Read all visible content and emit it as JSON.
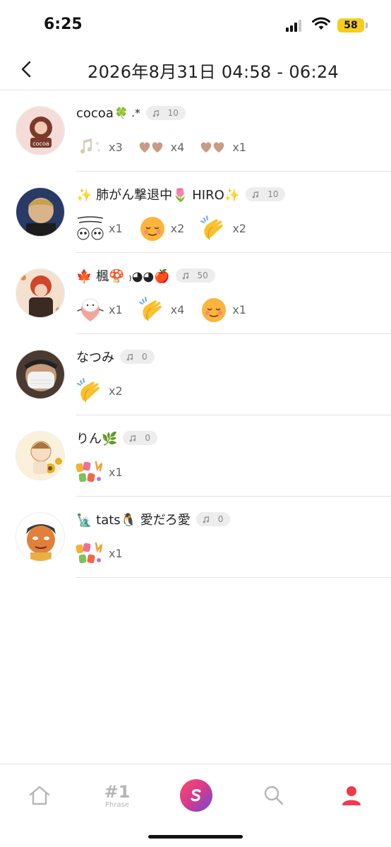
{
  "status_bar": {
    "time": "6:25",
    "battery": "58"
  },
  "header": {
    "title": "2026年8月31日 04:58 - 06:24",
    "back_icon": "chevron-left-icon"
  },
  "listeners": [
    {
      "name": "cocoa",
      "name_suffix": "🍀 .*",
      "notes": "10",
      "avatar_colors": [
        "#f6dcd8",
        "#7a3a2a"
      ],
      "reactions": [
        {
          "sticker": "music-notes-sticker",
          "count": "x3"
        },
        {
          "sticker": "hearts-sticker",
          "count": "x4"
        },
        {
          "sticker": "hearts-sticker",
          "count": "x1"
        }
      ]
    },
    {
      "name": "✨ 肺がん撃退中🌷 HIRO✨",
      "name_suffix": "",
      "notes": "10",
      "avatar_colors": [
        "#2a3a66",
        "#d9b48a"
      ],
      "reactions": [
        {
          "sticker": "pandas-thanks-sticker",
          "count": "x1"
        },
        {
          "sticker": "relieved-face-sticker",
          "count": "x2"
        },
        {
          "sticker": "clapping-hands-sticker",
          "count": "x2"
        }
      ]
    },
    {
      "name": "🍁 楓🍄 ₎◕◕🍎",
      "name_suffix": "",
      "notes": "50",
      "avatar_colors": [
        "#e88a4a",
        "#3a2a22"
      ],
      "reactions": [
        {
          "sticker": "heart-ghost-sticker",
          "count": "x1"
        },
        {
          "sticker": "clapping-hands-sticker",
          "count": "x4"
        },
        {
          "sticker": "relieved-face-sticker",
          "count": "x1"
        }
      ]
    },
    {
      "name": "なつみ",
      "name_suffix": "",
      "notes": "0",
      "avatar_colors": [
        "#cfcac4",
        "#4a3a32"
      ],
      "reactions": [
        {
          "sticker": "clapping-hands-sticker",
          "count": "x2"
        }
      ]
    },
    {
      "name": "りん🌿",
      "name_suffix": "",
      "notes": "0",
      "avatar_colors": [
        "#fbf1da",
        "#e9b020"
      ],
      "reactions": [
        {
          "sticker": "colorful-text-sticker",
          "count": "x1"
        }
      ]
    },
    {
      "name": "🗽 tats🐧 愛だろ愛",
      "name_suffix": "",
      "notes": "0",
      "avatar_colors": [
        "#ffffff",
        "#e0803a"
      ],
      "reactions": [
        {
          "sticker": "colorful-text-sticker",
          "count": "x1"
        }
      ]
    }
  ],
  "bottom_nav": {
    "home_icon": "home-icon",
    "phrase_number": "#1",
    "phrase_label": "Phrase",
    "center_icon": "app-logo-icon",
    "search_icon": "search-icon",
    "profile_icon": "profile-icon",
    "active_color": "#f0394e",
    "inactive_color": "#b5b5b5"
  }
}
